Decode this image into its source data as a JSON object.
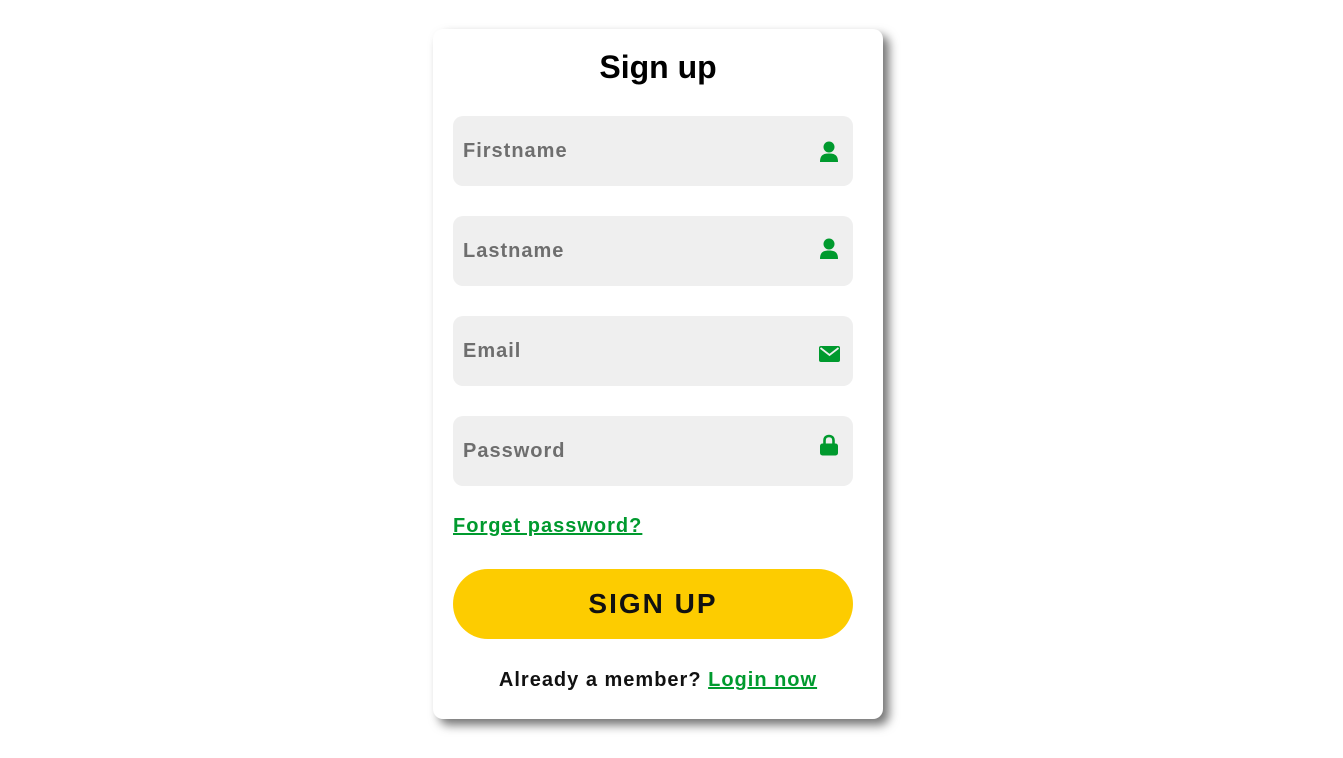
{
  "form": {
    "title": "Sign up",
    "fields": [
      {
        "placeholder": "Firstname",
        "value": "",
        "icon": "user-icon"
      },
      {
        "placeholder": "Lastname",
        "value": "",
        "icon": "user-icon"
      },
      {
        "placeholder": "Email",
        "value": "",
        "icon": "envelope-icon"
      },
      {
        "placeholder": "Password",
        "value": "",
        "icon": "lock-icon"
      }
    ],
    "forgot_label": "Forget password?",
    "submit_label": "SIGN UP",
    "footer_text": "Already a member?",
    "login_label": "Login now"
  },
  "colors": {
    "accent": "#009a2e",
    "button": "#fdcc00",
    "field_bg": "#efefef"
  }
}
